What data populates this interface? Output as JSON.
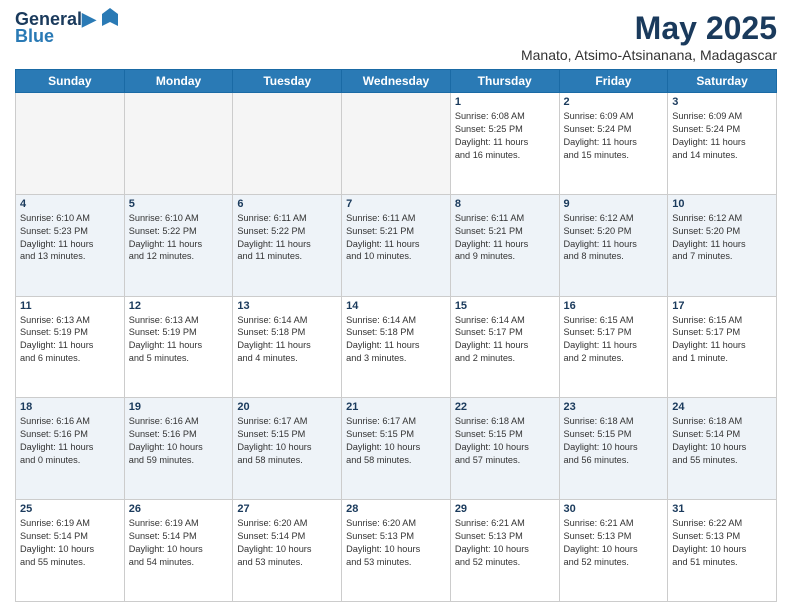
{
  "header": {
    "logo_line1": "General",
    "logo_line2": "Blue",
    "month": "May 2025",
    "location": "Manato, Atsimo-Atsinanana, Madagascar"
  },
  "days_of_week": [
    "Sunday",
    "Monday",
    "Tuesday",
    "Wednesday",
    "Thursday",
    "Friday",
    "Saturday"
  ],
  "weeks": [
    [
      {
        "day": "",
        "info": ""
      },
      {
        "day": "",
        "info": ""
      },
      {
        "day": "",
        "info": ""
      },
      {
        "day": "",
        "info": ""
      },
      {
        "day": "1",
        "info": "Sunrise: 6:08 AM\nSunset: 5:25 PM\nDaylight: 11 hours\nand 16 minutes."
      },
      {
        "day": "2",
        "info": "Sunrise: 6:09 AM\nSunset: 5:24 PM\nDaylight: 11 hours\nand 15 minutes."
      },
      {
        "day": "3",
        "info": "Sunrise: 6:09 AM\nSunset: 5:24 PM\nDaylight: 11 hours\nand 14 minutes."
      }
    ],
    [
      {
        "day": "4",
        "info": "Sunrise: 6:10 AM\nSunset: 5:23 PM\nDaylight: 11 hours\nand 13 minutes."
      },
      {
        "day": "5",
        "info": "Sunrise: 6:10 AM\nSunset: 5:22 PM\nDaylight: 11 hours\nand 12 minutes."
      },
      {
        "day": "6",
        "info": "Sunrise: 6:11 AM\nSunset: 5:22 PM\nDaylight: 11 hours\nand 11 minutes."
      },
      {
        "day": "7",
        "info": "Sunrise: 6:11 AM\nSunset: 5:21 PM\nDaylight: 11 hours\nand 10 minutes."
      },
      {
        "day": "8",
        "info": "Sunrise: 6:11 AM\nSunset: 5:21 PM\nDaylight: 11 hours\nand 9 minutes."
      },
      {
        "day": "9",
        "info": "Sunrise: 6:12 AM\nSunset: 5:20 PM\nDaylight: 11 hours\nand 8 minutes."
      },
      {
        "day": "10",
        "info": "Sunrise: 6:12 AM\nSunset: 5:20 PM\nDaylight: 11 hours\nand 7 minutes."
      }
    ],
    [
      {
        "day": "11",
        "info": "Sunrise: 6:13 AM\nSunset: 5:19 PM\nDaylight: 11 hours\nand 6 minutes."
      },
      {
        "day": "12",
        "info": "Sunrise: 6:13 AM\nSunset: 5:19 PM\nDaylight: 11 hours\nand 5 minutes."
      },
      {
        "day": "13",
        "info": "Sunrise: 6:14 AM\nSunset: 5:18 PM\nDaylight: 11 hours\nand 4 minutes."
      },
      {
        "day": "14",
        "info": "Sunrise: 6:14 AM\nSunset: 5:18 PM\nDaylight: 11 hours\nand 3 minutes."
      },
      {
        "day": "15",
        "info": "Sunrise: 6:14 AM\nSunset: 5:17 PM\nDaylight: 11 hours\nand 2 minutes."
      },
      {
        "day": "16",
        "info": "Sunrise: 6:15 AM\nSunset: 5:17 PM\nDaylight: 11 hours\nand 2 minutes."
      },
      {
        "day": "17",
        "info": "Sunrise: 6:15 AM\nSunset: 5:17 PM\nDaylight: 11 hours\nand 1 minute."
      }
    ],
    [
      {
        "day": "18",
        "info": "Sunrise: 6:16 AM\nSunset: 5:16 PM\nDaylight: 11 hours\nand 0 minutes."
      },
      {
        "day": "19",
        "info": "Sunrise: 6:16 AM\nSunset: 5:16 PM\nDaylight: 10 hours\nand 59 minutes."
      },
      {
        "day": "20",
        "info": "Sunrise: 6:17 AM\nSunset: 5:15 PM\nDaylight: 10 hours\nand 58 minutes."
      },
      {
        "day": "21",
        "info": "Sunrise: 6:17 AM\nSunset: 5:15 PM\nDaylight: 10 hours\nand 58 minutes."
      },
      {
        "day": "22",
        "info": "Sunrise: 6:18 AM\nSunset: 5:15 PM\nDaylight: 10 hours\nand 57 minutes."
      },
      {
        "day": "23",
        "info": "Sunrise: 6:18 AM\nSunset: 5:15 PM\nDaylight: 10 hours\nand 56 minutes."
      },
      {
        "day": "24",
        "info": "Sunrise: 6:18 AM\nSunset: 5:14 PM\nDaylight: 10 hours\nand 55 minutes."
      }
    ],
    [
      {
        "day": "25",
        "info": "Sunrise: 6:19 AM\nSunset: 5:14 PM\nDaylight: 10 hours\nand 55 minutes."
      },
      {
        "day": "26",
        "info": "Sunrise: 6:19 AM\nSunset: 5:14 PM\nDaylight: 10 hours\nand 54 minutes."
      },
      {
        "day": "27",
        "info": "Sunrise: 6:20 AM\nSunset: 5:14 PM\nDaylight: 10 hours\nand 53 minutes."
      },
      {
        "day": "28",
        "info": "Sunrise: 6:20 AM\nSunset: 5:13 PM\nDaylight: 10 hours\nand 53 minutes."
      },
      {
        "day": "29",
        "info": "Sunrise: 6:21 AM\nSunset: 5:13 PM\nDaylight: 10 hours\nand 52 minutes."
      },
      {
        "day": "30",
        "info": "Sunrise: 6:21 AM\nSunset: 5:13 PM\nDaylight: 10 hours\nand 52 minutes."
      },
      {
        "day": "31",
        "info": "Sunrise: 6:22 AM\nSunset: 5:13 PM\nDaylight: 10 hours\nand 51 minutes."
      }
    ]
  ]
}
